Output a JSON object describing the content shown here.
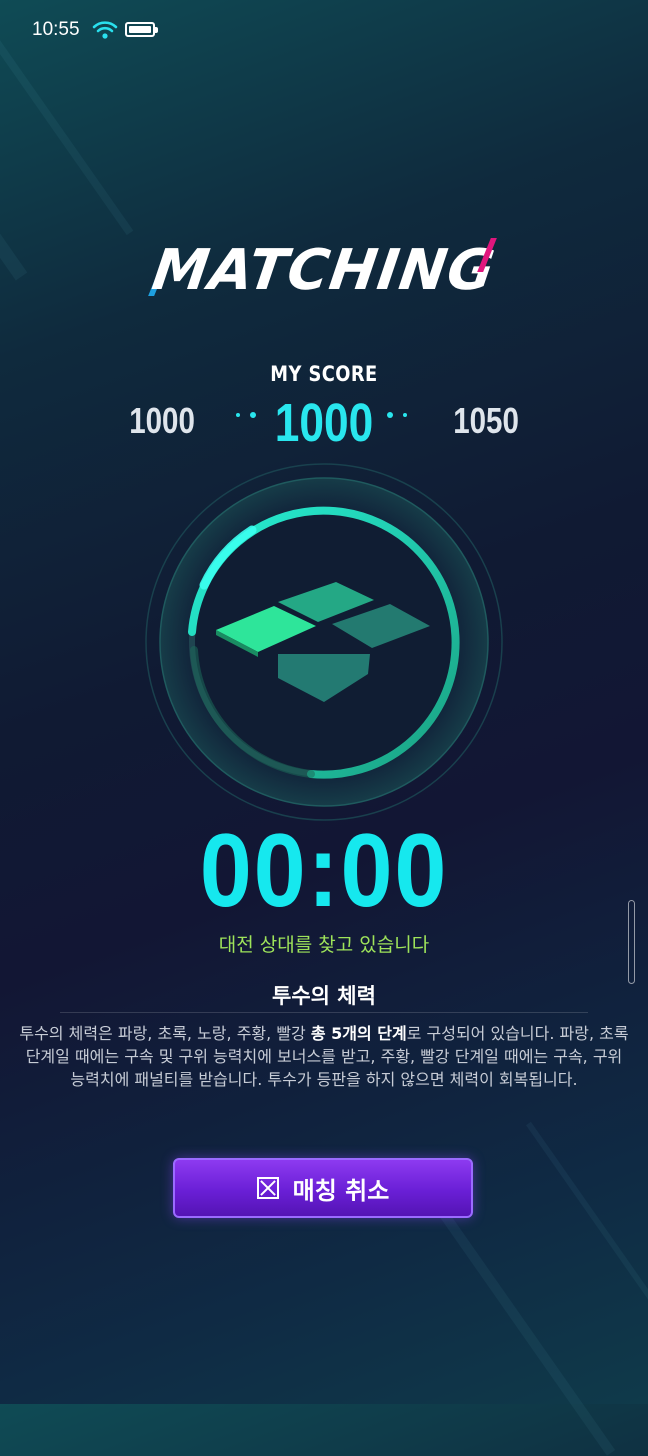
{
  "status_bar": {
    "time": "10:55"
  },
  "header": {
    "title": "MATCHING"
  },
  "score": {
    "label": "MY SCORE",
    "current": "1000",
    "range_low": "1000",
    "range_high": "1050"
  },
  "timer": {
    "value": "00:00"
  },
  "status_message": "대전 상대를 찾고 있습니다",
  "info": {
    "title": "투수의 체력",
    "body_prefix": "투수의 체력은 파랑, 초록, 노랑, 주황, 빨강 ",
    "body_bold": "총 5개의 단계",
    "body_suffix": "로 구성되어 있습니다. 파랑, 초록 단계일 때에는 구속 및 구위 능력치에 보너스를 받고, 주황, 빨강 단계일 때에는 구속, 구위 능력치에 패널티를 받습니다. 투수가 등판을 하지 않으면 체력이 회복됩니다."
  },
  "cancel_button": {
    "label": "매칭 취소",
    "icon": "close-box-icon"
  },
  "colors": {
    "accent": "#29e6ee",
    "timer": "#16e8ee",
    "message": "#9ee35a",
    "button": "#6a1fd6",
    "slash_blue": "#1ea0e0",
    "slash_pink": "#e0167d"
  }
}
